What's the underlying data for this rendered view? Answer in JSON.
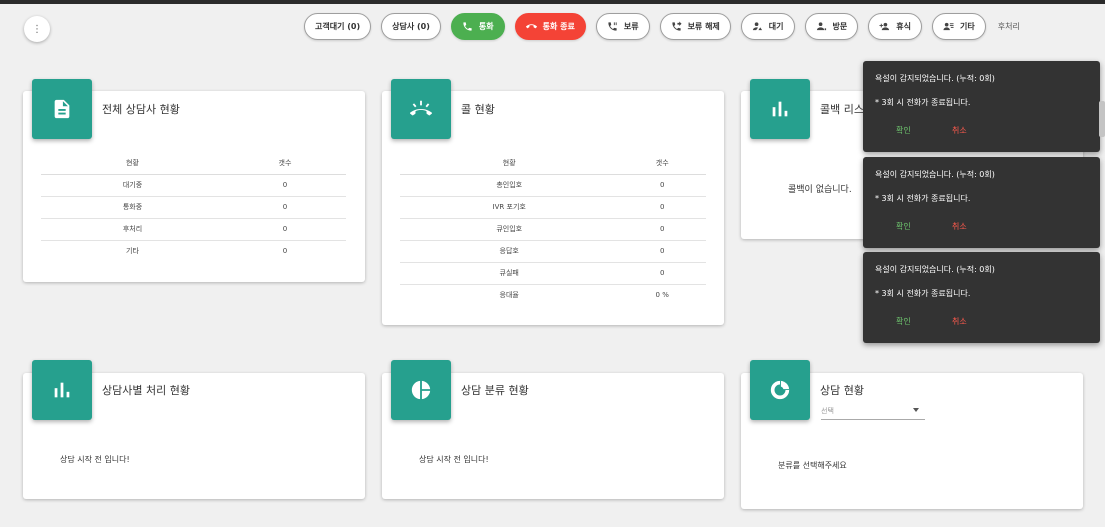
{
  "toolbar": {
    "customer_wait": "고객대기 (0)",
    "agents": "상담사 (0)",
    "call": "통화",
    "end_call": "통화 종료",
    "hold": "보류",
    "unhold": "보류 해제",
    "standby": "대기",
    "visit": "방문",
    "break": "휴식",
    "other": "기타",
    "wrapup": "후처리"
  },
  "cards": {
    "agents_status": {
      "title": "전체 상담사 현황",
      "col_status": "현황",
      "col_count": "갯수",
      "rows": [
        {
          "label": "대기중",
          "value": "0"
        },
        {
          "label": "통화중",
          "value": "0"
        },
        {
          "label": "후처리",
          "value": "0"
        },
        {
          "label": "기타",
          "value": "0"
        }
      ]
    },
    "call_status": {
      "title": "콜 현황",
      "col_status": "현황",
      "col_count": "갯수",
      "rows": [
        {
          "label": "총인입호",
          "value": "0"
        },
        {
          "label": "IVR 포기호",
          "value": "0"
        },
        {
          "label": "큐인입호",
          "value": "0"
        },
        {
          "label": "응답호",
          "value": "0"
        },
        {
          "label": "큐실패",
          "value": "0"
        },
        {
          "label": "응대율",
          "value": "0 %"
        }
      ]
    },
    "callback": {
      "title": "콜백 리스",
      "empty": "콜백이 없습니다."
    },
    "agent_processing": {
      "title": "상담사별 처리 현황",
      "empty": "상담 시작 전 입니다!"
    },
    "category": {
      "title": "상담 분류 현황",
      "empty": "상담 시작 전 입니다!"
    },
    "consult_status": {
      "title": "상담 현황",
      "select_placeholder": "선택",
      "empty": "분류를 선택해주세요"
    }
  },
  "toasts": [
    {
      "message": "욕설이 감지되었습니다. (누적: 0회)",
      "detail": "* 3회 시 전화가 종료됩니다.",
      "ok": "확인",
      "cancel": "취소"
    },
    {
      "message": "욕설이 감지되었습니다. (누적: 0회)",
      "detail": "* 3회 시 전화가 종료됩니다.",
      "ok": "확인",
      "cancel": "취소"
    },
    {
      "message": "욕설이 감지되었습니다. (누적: 0회)",
      "detail": "* 3회 시 전화가 종료됩니다.",
      "ok": "확인",
      "cancel": "취소"
    }
  ],
  "colors": {
    "accent": "#26a08e",
    "call_green": "#4caf50",
    "end_red": "#f44336",
    "toast_bg": "#333333"
  }
}
